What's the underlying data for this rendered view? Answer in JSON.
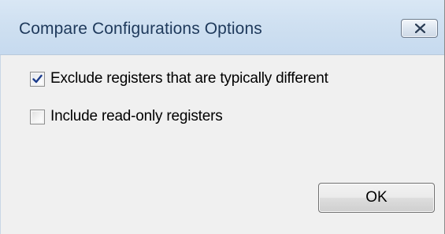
{
  "window": {
    "title": "Compare Configurations Options",
    "close_icon": "close-x-icon"
  },
  "options": [
    {
      "label": "Exclude registers that are typically different",
      "checked": true
    },
    {
      "label": "Include read-only registers",
      "checked": false
    }
  ],
  "buttons": {
    "ok_label": "OK"
  },
  "colors": {
    "title_text": "#1e395b",
    "titlebar_bg": "#cfe0f1",
    "client_bg": "#f0f0f0",
    "checkmark": "#1c3c8c"
  }
}
